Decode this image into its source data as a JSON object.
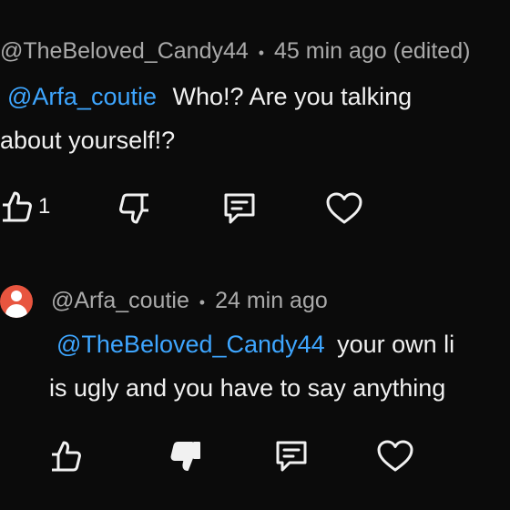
{
  "comment1": {
    "author": "@TheBeloved_Candy44",
    "separator": "•",
    "time": "45 min ago",
    "edited": "(edited)",
    "mention": "@Arfa_coutie",
    "text_line1": "Who!? Are you talking",
    "text_line2": "about yourself!?",
    "like_count": "1"
  },
  "comment2": {
    "author": "@Arfa_coutie",
    "separator": "•",
    "time": "24 min ago",
    "mention": "@TheBeloved_Candy44",
    "text_line1_rest": "your own li",
    "text_line2": "is ugly and you have to say anything"
  },
  "colors": {
    "background": "#0b0b0b",
    "text": "#f1f1f1",
    "meta": "#aaaaaa",
    "mention": "#3ea6ff",
    "avatar": "#e8553f"
  },
  "icons": [
    "thumbs-up-icon",
    "thumbs-down-icon",
    "reply-icon",
    "heart-icon"
  ]
}
